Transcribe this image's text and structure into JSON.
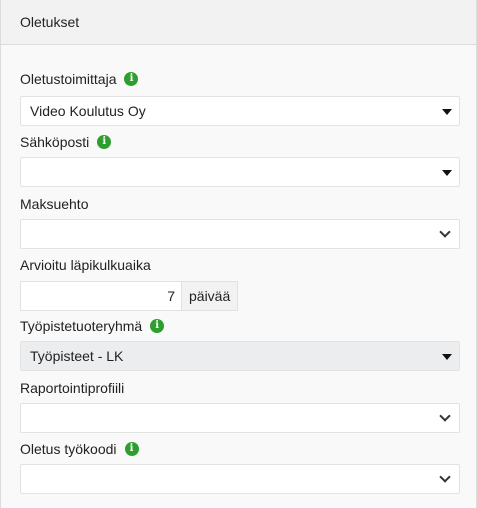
{
  "panel": {
    "title": "Oletukset"
  },
  "fields": {
    "default_supplier": {
      "label": "Oletustoimittaja",
      "value": "Video Koulutus Oy"
    },
    "email": {
      "label": "Sähköposti",
      "value": ""
    },
    "payment_term": {
      "label": "Maksuehto",
      "value": ""
    },
    "lead_time": {
      "label": "Arvioitu läpikulkuaika",
      "value": "7",
      "unit": "päivää"
    },
    "workpoint_group": {
      "label": "Työpistetuoteryhmä",
      "value": "Työpisteet - LK"
    },
    "report_profile": {
      "label": "Raportointiprofiili",
      "value": ""
    },
    "default_workcode": {
      "label": "Oletus työkoodi",
      "value": ""
    }
  },
  "icons": {
    "info": "info-icon",
    "dropdown_solid": "caret-down-icon",
    "dropdown_chevron": "chevron-down-icon"
  },
  "info_glyph": "i",
  "colors": {
    "info_badge": "#2e9e2e",
    "disabled_field": "#ebedef"
  }
}
